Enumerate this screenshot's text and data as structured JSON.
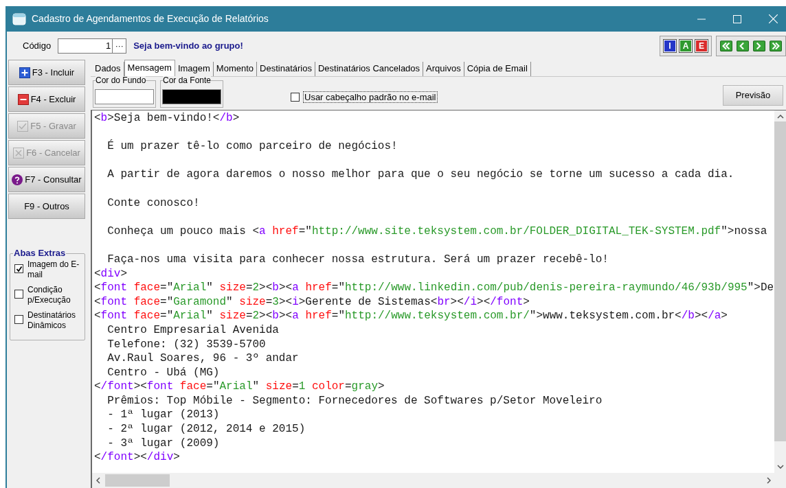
{
  "window": {
    "title": "Cadastro de Agendamentos de Execução de Relatórios"
  },
  "header": {
    "code_label": "Código",
    "code_value": "1",
    "lookup_button": "···",
    "welcome": "Seja bem-vindo ao grupo!"
  },
  "record_buttons": [
    {
      "label": "I",
      "color": "#2436c8"
    },
    {
      "label": "A",
      "color": "#2f9a2f"
    },
    {
      "label": "E",
      "color": "#d92b2b"
    }
  ],
  "navigation_buttons": [
    {
      "kind": "first"
    },
    {
      "kind": "previous"
    },
    {
      "kind": "next"
    },
    {
      "kind": "last"
    }
  ],
  "actions": [
    {
      "label": "F3 - Incluir",
      "kind": "add",
      "disabled": false
    },
    {
      "label": "F4 - Excluir",
      "kind": "remove",
      "disabled": false
    },
    {
      "label": "F5 - Gravar",
      "kind": "save",
      "disabled": true
    },
    {
      "label": "F6 - Cancelar",
      "kind": "cancel",
      "disabled": true
    },
    {
      "label": "F7 - Consultar",
      "kind": "help",
      "disabled": false
    },
    {
      "label": "F9 - Outros",
      "kind": "plain",
      "disabled": false
    }
  ],
  "extra_tabs": {
    "title": "Abas Extras",
    "items": [
      {
        "label": "Imagem do E-mail",
        "checked": true
      },
      {
        "label": "Condição p/Execução",
        "checked": false
      },
      {
        "label": "Destinatários Dinâmicos",
        "checked": false
      }
    ]
  },
  "tabs": [
    {
      "label": "Dados",
      "selected": false
    },
    {
      "label": "Mensagem",
      "selected": true
    },
    {
      "label": "Imagem",
      "selected": false
    },
    {
      "label": "Momento",
      "selected": false
    },
    {
      "label": "Destinatários",
      "selected": false
    },
    {
      "label": "Destinatários Cancelados",
      "selected": false
    },
    {
      "label": "Arquivos",
      "selected": false
    },
    {
      "label": "Cópia de Email",
      "selected": false
    }
  ],
  "colors": [
    {
      "label": "Cor do Fundo",
      "color": "#ffffff"
    },
    {
      "label": "Cor da Fonte",
      "color": "#000000"
    }
  ],
  "default_header": {
    "label": "Usar cabeçalho padrão no e-mail",
    "checked": false
  },
  "preview_button": "Previsão",
  "editor": {
    "lines": [
      {
        "text": "<b>Seja bem-vindo!</b>",
        "blank_before": false
      },
      {
        "text": "  É um prazer tê-lo como parceiro de negócios!",
        "blank_before": true
      },
      {
        "text": "  A partir de agora daremos o nosso melhor para que o seu negócio se torne um sucesso a cada dia.",
        "blank_before": true
      },
      {
        "text": "  Conte conosco!",
        "blank_before": true
      },
      {
        "text": "  Conheça um pouco mais <a href=\"http://www.site.teksystem.com.br/FOLDER_DIGITAL_TEK-SYSTEM.pdf\">nossa",
        "blank_before": true
      },
      {
        "text": "  Faça-nos uma visita para conhecer nossa estrutura. Será um prazer recebê-lo!",
        "blank_before": true
      },
      {
        "text": "<div>",
        "blank_before": false
      },
      {
        "text": "<font face=\"Arial\" size=2><b><a href=\"http://www.linkedin.com/pub/denis-pereira-raymundo/46/93b/995\">De",
        "blank_before": false
      },
      {
        "text": "<font face=\"Garamond\" size=3><i>Gerente de Sistemas<br></i></font>",
        "blank_before": false
      },
      {
        "text": "<font face=\"Arial\" size=2><b><a href=\"http://www.teksystem.com.br/\">www.teksystem.com.br</b></a>",
        "blank_before": false
      },
      {
        "text": "  Centro Empresarial Avenida",
        "blank_before": false
      },
      {
        "text": "  Telefone: (32) 3539-5700",
        "blank_before": false
      },
      {
        "text": "  Av.Raul Soares, 96 - 3º andar",
        "blank_before": false
      },
      {
        "text": "  Centro - Ubá (MG)",
        "blank_before": false
      },
      {
        "text": "</font><font face=\"Arial\" size=1 color=gray>",
        "blank_before": false
      },
      {
        "text": "  Prêmios: Top Móbile - Segmento: Fornecedores de Softwares p/Setor Moveleiro",
        "blank_before": false
      },
      {
        "text": "  - 1ª lugar (2013)",
        "blank_before": false
      },
      {
        "text": "  - 2ª lugar (2012, 2014 e 2015)",
        "blank_before": false
      },
      {
        "text": "  - 3ª lugar (2009)",
        "blank_before": false
      },
      {
        "text": "</font></div>",
        "blank_before": false
      }
    ]
  }
}
